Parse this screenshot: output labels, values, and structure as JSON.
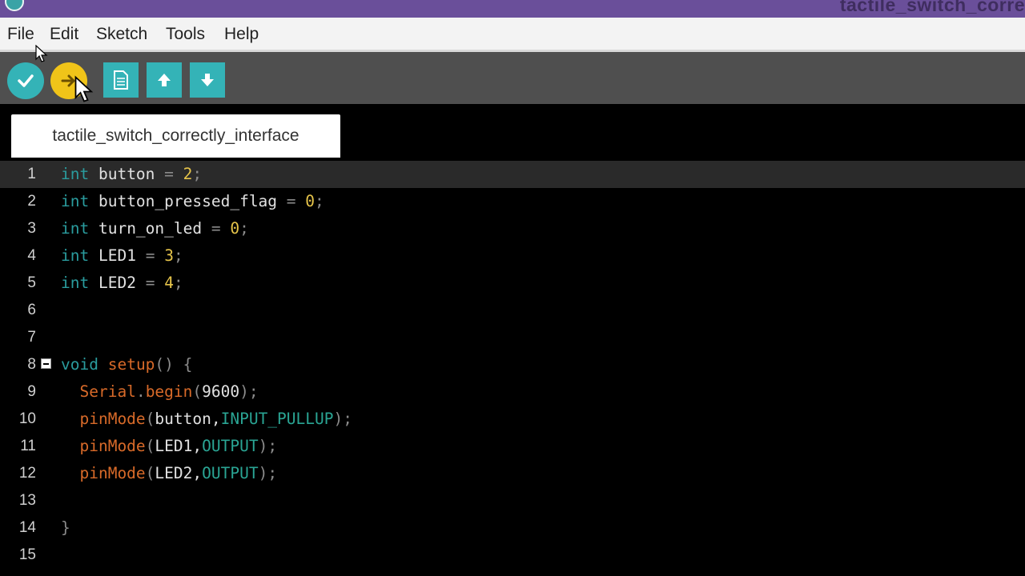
{
  "window": {
    "title": "tactile_switch_corre"
  },
  "menu": [
    "File",
    "Edit",
    "Sketch",
    "Tools",
    "Help"
  ],
  "toolbar": {
    "verify_icon": "check-icon",
    "upload_icon": "arrow-right-icon",
    "new_icon": "document-icon",
    "open_icon": "arrow-up-icon",
    "save_icon": "arrow-down-icon"
  },
  "tab": {
    "label": "tactile_switch_correctly_interface"
  },
  "editor": {
    "current_line": 1,
    "lines": [
      {
        "num": "1",
        "tokens": [
          [
            "type",
            "int"
          ],
          [
            "ident",
            " button "
          ],
          [
            "punct",
            "="
          ],
          [
            "ident",
            " "
          ],
          [
            "num",
            "2"
          ],
          [
            "punct",
            ";"
          ]
        ]
      },
      {
        "num": "2",
        "tokens": [
          [
            "type",
            "int"
          ],
          [
            "ident",
            " button_pressed_flag "
          ],
          [
            "punct",
            "="
          ],
          [
            "ident",
            " "
          ],
          [
            "num",
            "0"
          ],
          [
            "punct",
            ";"
          ]
        ]
      },
      {
        "num": "3",
        "tokens": [
          [
            "type",
            "int"
          ],
          [
            "ident",
            " turn_on_led "
          ],
          [
            "punct",
            "="
          ],
          [
            "ident",
            " "
          ],
          [
            "num",
            "0"
          ],
          [
            "punct",
            ";"
          ]
        ]
      },
      {
        "num": "4",
        "tokens": [
          [
            "type",
            "int"
          ],
          [
            "ident",
            " LED1 "
          ],
          [
            "punct",
            "="
          ],
          [
            "ident",
            " "
          ],
          [
            "num",
            "3"
          ],
          [
            "punct",
            ";"
          ]
        ]
      },
      {
        "num": "5",
        "tokens": [
          [
            "type",
            "int"
          ],
          [
            "ident",
            " LED2 "
          ],
          [
            "punct",
            "="
          ],
          [
            "ident",
            " "
          ],
          [
            "num",
            "4"
          ],
          [
            "punct",
            ";"
          ]
        ]
      },
      {
        "num": "6",
        "tokens": []
      },
      {
        "num": "7",
        "tokens": []
      },
      {
        "num": "8",
        "fold": true,
        "tokens": [
          [
            "type",
            "void"
          ],
          [
            "ident",
            " "
          ],
          [
            "fn",
            "setup"
          ],
          [
            "punct",
            "() {"
          ]
        ]
      },
      {
        "num": "9",
        "tokens": [
          [
            "ident",
            "  "
          ],
          [
            "fn",
            "Serial"
          ],
          [
            "punct",
            "."
          ],
          [
            "fn",
            "begin"
          ],
          [
            "punct",
            "("
          ],
          [
            "ident",
            "9600"
          ],
          [
            "punct",
            ");"
          ]
        ]
      },
      {
        "num": "10",
        "tokens": [
          [
            "ident",
            "  "
          ],
          [
            "fn",
            "pinMode"
          ],
          [
            "punct",
            "("
          ],
          [
            "ident",
            "button,"
          ],
          [
            "const",
            "INPUT_PULLUP"
          ],
          [
            "punct",
            ");"
          ]
        ]
      },
      {
        "num": "11",
        "tokens": [
          [
            "ident",
            "  "
          ],
          [
            "fn",
            "pinMode"
          ],
          [
            "punct",
            "("
          ],
          [
            "ident",
            "LED1,"
          ],
          [
            "const",
            "OUTPUT"
          ],
          [
            "punct",
            ");"
          ]
        ]
      },
      {
        "num": "12",
        "tokens": [
          [
            "ident",
            "  "
          ],
          [
            "fn",
            "pinMode"
          ],
          [
            "punct",
            "("
          ],
          [
            "ident",
            "LED2,"
          ],
          [
            "const",
            "OUTPUT"
          ],
          [
            "punct",
            ");"
          ]
        ]
      },
      {
        "num": "13",
        "tokens": []
      },
      {
        "num": "14",
        "tokens": [
          [
            "punct",
            "}"
          ]
        ]
      },
      {
        "num": "15",
        "tokens": []
      }
    ]
  },
  "colors": {
    "titlebar": "#6a4f9a",
    "toolbar": "#4f4f4f",
    "accent_teal": "#34b3b7",
    "upload_yellow": "#f0c419",
    "editor_bg": "#000000"
  }
}
